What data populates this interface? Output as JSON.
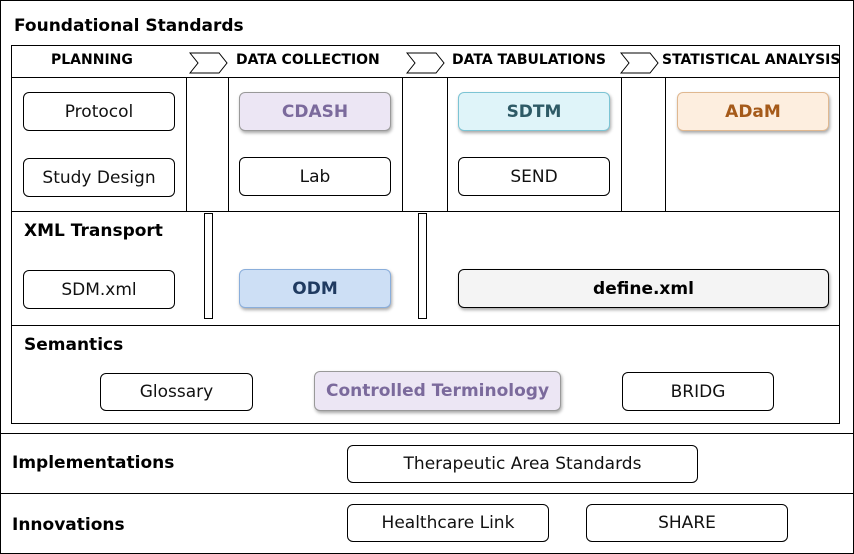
{
  "foundational": {
    "title": "Foundational Standards",
    "phases": [
      "PLANNING",
      "DATA COLLECTION",
      "DATA TABULATIONS",
      "STATISTICAL ANALYSIS"
    ],
    "planning": [
      "Protocol",
      "Study Design"
    ],
    "collection": [
      "CDASH",
      "Lab"
    ],
    "tabulation": [
      "SDTM",
      "SEND"
    ],
    "analysis": [
      "ADaM"
    ],
    "xml": {
      "title": "XML Transport",
      "items": [
        "SDM.xml",
        "ODM",
        "define.xml"
      ]
    },
    "semantics": {
      "title": "Semantics",
      "items": [
        "Glossary",
        "Controlled Terminology",
        "BRIDG"
      ]
    }
  },
  "implementations": {
    "title": "Implementations",
    "items": [
      "Therapeutic Area Standards"
    ]
  },
  "innovations": {
    "title": "Innovations",
    "items": [
      "Healthcare Link",
      "SHARE"
    ]
  },
  "colors": {
    "cdash_fill": "#ece6f4",
    "cdash_text": "#7b6a9c",
    "sdtm_fill": "#dff4f9",
    "sdtm_text": "#2e5a66",
    "adam_fill": "#fdeedf",
    "adam_text": "#a55a1a",
    "odm_fill": "#cddff5",
    "odm_text": "#1f3a60",
    "define_fill": "#f4f4f4",
    "ct_fill": "#ece6f4",
    "ct_text": "#7b6a9c"
  }
}
